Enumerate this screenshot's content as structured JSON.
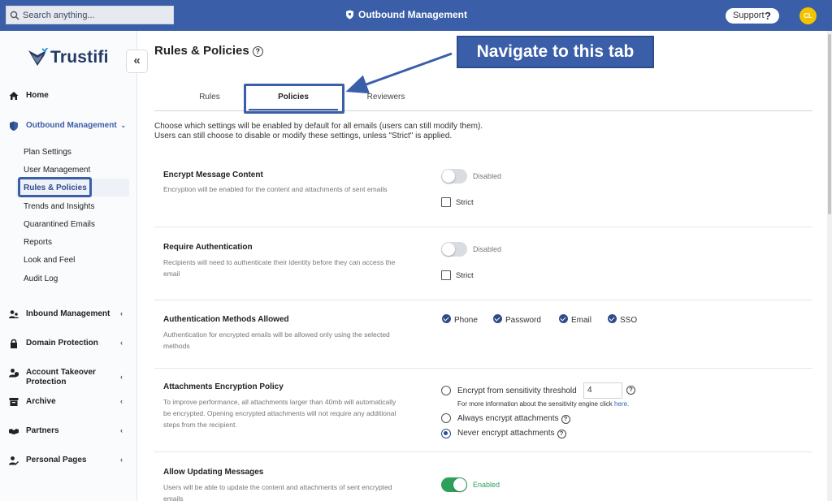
{
  "header": {
    "search_placeholder": "Search anything...",
    "title": "Outbound Management",
    "support_label": "Support",
    "support_icon": "?",
    "avatar_initials": "CL",
    "bar_color": "#3a5ea8"
  },
  "sidebar": {
    "brand": "Trustifi",
    "collapse_glyph": "«",
    "items": [
      {
        "label": "Home",
        "icon": "home-icon"
      },
      {
        "label": "Outbound Management",
        "icon": "shield-icon",
        "expanded": true
      },
      {
        "label": "Inbound Management",
        "icon": "users-icon"
      },
      {
        "label": "Domain Protection",
        "icon": "lock-icon"
      },
      {
        "label": "Account Takeover Protection",
        "icon": "user-shield-icon"
      },
      {
        "label": "Archive",
        "icon": "archive-icon"
      },
      {
        "label": "Partners",
        "icon": "handshake-icon"
      },
      {
        "label": "Personal Pages",
        "icon": "user-edit-icon"
      }
    ],
    "subitems": [
      "Plan Settings",
      "User Management",
      "Rules & Policies",
      "Trends and Insights",
      "Quarantined Emails",
      "Reports",
      "Look and Feel",
      "Audit Log"
    ]
  },
  "main": {
    "page_title": "Rules & Policies",
    "annotation": "Navigate to this tab",
    "tabs": [
      "Rules",
      "Policies",
      "Reviewers"
    ],
    "active_tab": "Policies",
    "intro_line1": "Choose which settings will be enabled by default for all emails (users can still modify them).",
    "intro_line2": "Users can still choose to disable or modify these settings, unless \"Strict\" is applied.",
    "sections": [
      {
        "title": "Encrypt Message Content",
        "desc": "Encryption will be enabled for the content and attachments of sent emails",
        "toggle_label": "Disabled",
        "strict_label": "Strict"
      },
      {
        "title": "Require Authentication",
        "desc": "Recipients will need to authenticate their identity before they can access the email",
        "toggle_label": "Disabled",
        "strict_label": "Strict"
      },
      {
        "title": "Authentication Methods Allowed",
        "desc": "Authentication for encrypted emails will be allowed only using the selected methods",
        "methods": [
          "Phone",
          "Password",
          "Email",
          "SSO"
        ]
      },
      {
        "title": "Attachments Encryption Policy",
        "desc": "To improve performance, all attachments larger than 40mb will automatically be encrypted. Opening encrypted attachments will not require any additional steps from the recipient.",
        "option1": "Encrypt from sensitivity threshold",
        "threshold_value": "4",
        "hint_text": "For more information about the sensitivity engine click",
        "hint_link": "here.",
        "option2": "Always encrypt attachments",
        "option3": "Never encrypt attachments",
        "selected_option": "Never encrypt attachments"
      },
      {
        "title": "Allow Updating Messages",
        "desc": "Users will be able to update the content and attachments of sent encrypted emails",
        "toggle_label": "Enabled"
      }
    ]
  }
}
